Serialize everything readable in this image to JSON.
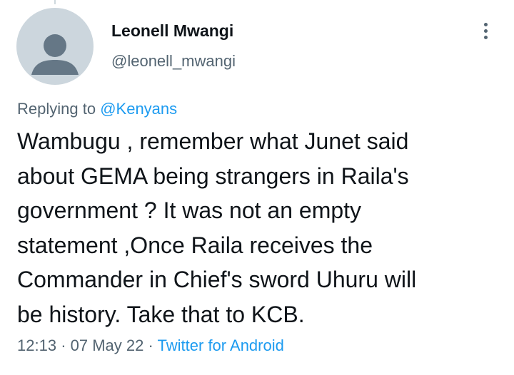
{
  "author": {
    "display_name": "Leonell Mwangi",
    "handle": "@leonell_mwangi",
    "avatar_icon": "default-profile-silhouette-icon"
  },
  "reply": {
    "prefix": "Replying to",
    "mention": "@Kenyans"
  },
  "tweet": {
    "lines": [
      "Wambugu , remember what Junet said",
      "about GEMA being strangers in Raila's",
      "government ? It was not an empty",
      "statement ,Once Raila receives the",
      "Commander in Chief's sword Uhuru will",
      "be history. Take that to KCB."
    ]
  },
  "meta": {
    "time": "12:13",
    "separator": "·",
    "date": "07 May 22",
    "source": "Twitter for Android"
  },
  "menu": {
    "icon": "more-vertical-icon"
  },
  "colors": {
    "link": "#1d9bf0",
    "secondary_text": "#536471",
    "primary_text": "#0f1419",
    "avatar_background": "#ccd6dd",
    "avatar_figure": "#657786"
  }
}
